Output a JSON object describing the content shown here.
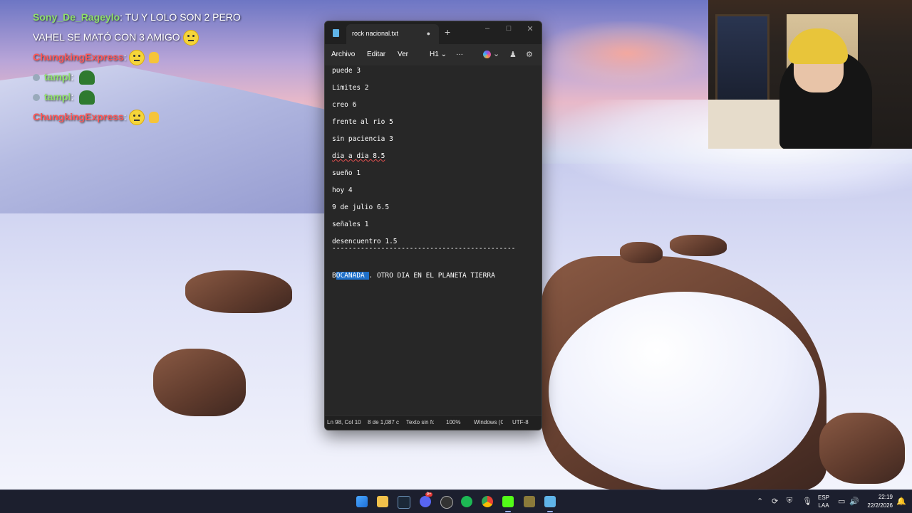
{
  "chat": [
    {
      "user": "Sony_De_Rageylo",
      "message": ": TU Y LOLO SON 2 PERO",
      "continuation": "VAHEL SE MATÓ CON 3 AMIGO"
    },
    {
      "user": "ChungkingExpress",
      "message": ":"
    },
    {
      "user": "tampl",
      "message": ":"
    },
    {
      "user": "tampl",
      "message": ":"
    },
    {
      "user": "ChungkingExpress",
      "message": ":"
    }
  ],
  "notepad": {
    "tab_title": "rock nacional.txt",
    "tab_modified": "●",
    "new_tab": "+",
    "window_controls": {
      "minimize": "–",
      "maximize": "□",
      "close": "✕"
    },
    "menu": {
      "file": "Archivo",
      "edit": "Editar",
      "view": "Ver",
      "heading": "H1",
      "more": "···"
    },
    "lines": [
      "puede 3",
      "Limites 2",
      "creo 6",
      "frente al rio 5",
      "sin paciencia 3",
      "dia a dia 8.5",
      "sueño 1",
      "hoy 4",
      "9 de julio 6.5",
      "señales 1",
      "desencuentro 1.5",
      "---------------------------------------------"
    ],
    "current_line": {
      "first_char": "B",
      "selected": "OCANADA ",
      "rest": ". OTRO DIA EN EL PLANETA TIERRA"
    },
    "status": {
      "position": "Ln 98, Col 10",
      "selection": "8 de 1,087 c",
      "format": "Texto sin fo",
      "zoom": "100%",
      "line_ending": "Windows (C",
      "encoding": "UTF-8"
    }
  },
  "taskbar": {
    "language": "ESP",
    "layout": "LAA",
    "time": "22:19",
    "date": "22/2/2026",
    "discord_badge": "9+"
  },
  "colors": {
    "accent": "#1e6fc8",
    "chat_green": "#8fe06a",
    "chat_red": "#ff5858"
  }
}
